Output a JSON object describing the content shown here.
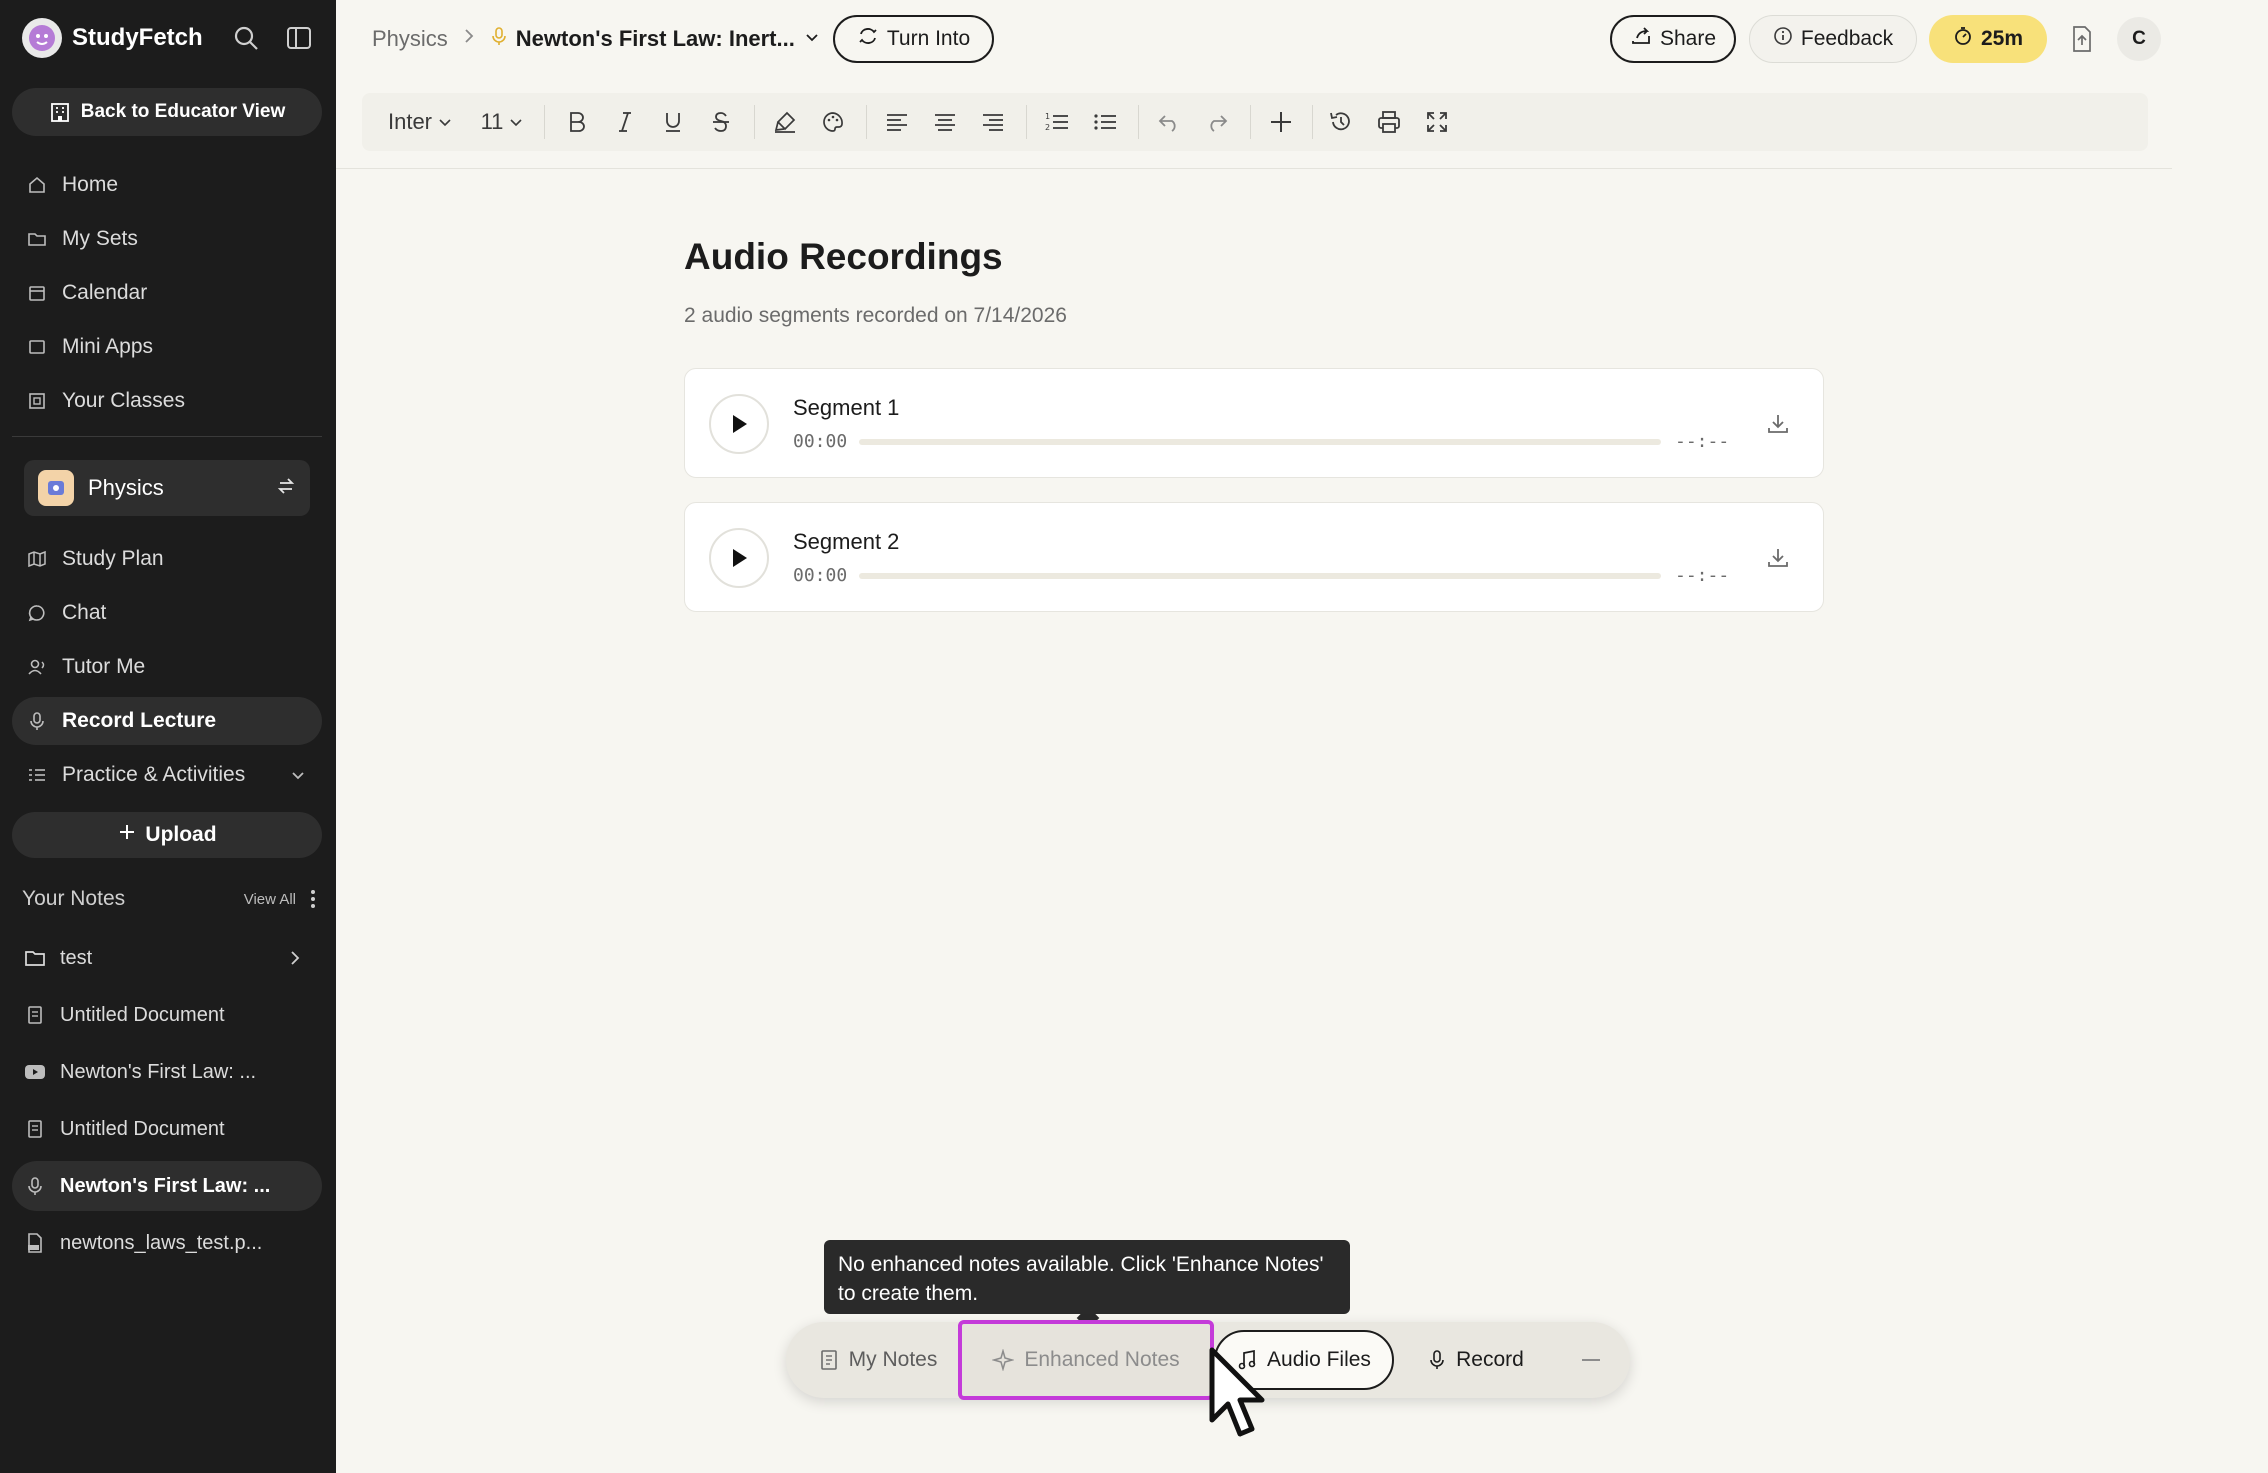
{
  "sidebar": {
    "brand": "StudyFetch",
    "back_button": "Back to Educator View",
    "nav": [
      {
        "label": "Home",
        "icon": "home-icon"
      },
      {
        "label": "My Sets",
        "icon": "folder-icon"
      },
      {
        "label": "Calendar",
        "icon": "calendar-icon"
      },
      {
        "label": "Mini Apps",
        "icon": "window-icon"
      },
      {
        "label": "Your Classes",
        "icon": "classes-icon"
      }
    ],
    "class_name": "Physics",
    "class_nav": [
      {
        "label": "Study Plan",
        "icon": "map-icon"
      },
      {
        "label": "Chat",
        "icon": "chat-icon"
      },
      {
        "label": "Tutor Me",
        "icon": "tutor-icon"
      },
      {
        "label": "Record Lecture",
        "icon": "mic-icon"
      },
      {
        "label": "Practice & Activities",
        "icon": "list-icon"
      }
    ],
    "upload_label": "Upload",
    "notes_title": "Your Notes",
    "view_all": "View All",
    "notes": [
      {
        "label": "test",
        "icon": "folder-icon"
      },
      {
        "label": "Untitled Document",
        "icon": "document-icon"
      },
      {
        "label": "Newton's First Law: ...",
        "icon": "youtube-icon"
      },
      {
        "label": "Untitled Document",
        "icon": "document-icon"
      },
      {
        "label": "Newton's First Law: ...",
        "icon": "mic-icon"
      },
      {
        "label": "newtons_laws_test.p...",
        "icon": "pdf-icon"
      }
    ]
  },
  "header": {
    "breadcrumb_root": "Physics",
    "breadcrumb_current": "Newton's First Law: Inert...",
    "turn_into": "Turn Into",
    "share": "Share",
    "feedback": "Feedback",
    "timer": "25m",
    "avatar_initial": "C",
    "accent_yellow": "#f8e17a"
  },
  "toolbar": {
    "font": "Inter",
    "size": "11"
  },
  "main": {
    "title": "Audio Recordings",
    "subtitle": "2 audio segments recorded on 7/14/2026",
    "segments": [
      {
        "name": "Segment 1",
        "current": "00:00",
        "duration": "--:--",
        "progress": 0
      },
      {
        "name": "Segment 2",
        "current": "00:00",
        "duration": "--:--",
        "progress": 0
      }
    ]
  },
  "dock": {
    "tooltip": "No enhanced notes available. Click 'Enhance Notes' to create them.",
    "my_notes": "My Notes",
    "enhanced_notes": "Enhanced Notes",
    "audio_files": "Audio Files",
    "record": "Record",
    "highlight_color": "#c43bd9"
  }
}
